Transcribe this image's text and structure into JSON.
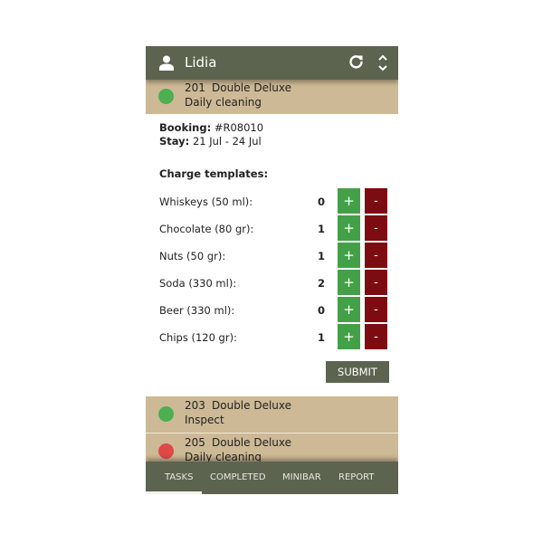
{
  "header": {
    "user_name": "Lidia",
    "icons": [
      "user-icon",
      "refresh-icon",
      "expand-collapse-icon"
    ]
  },
  "colors": {
    "header_bg": "#5c6450",
    "room_bg": "#cdb995",
    "status_green": "#4caf50",
    "status_red": "#e04848",
    "plus_bg": "#43a047",
    "minus_bg": "#7d0c12"
  },
  "rooms": [
    {
      "number": "201",
      "type": "Double Deluxe",
      "task": "Daily cleaning",
      "status": "green"
    },
    {
      "number": "203",
      "type": "Double Deluxe",
      "task": "Inspect",
      "status": "green"
    },
    {
      "number": "205",
      "type": "Double Deluxe",
      "task": "Daily cleaning",
      "status": "red"
    }
  ],
  "details": {
    "booking_label": "Booking:",
    "booking_value": "#R08010",
    "stay_label": "Stay:",
    "stay_value": "21 Jul - 24 Jul",
    "charge_templates_label": "Charge templates:",
    "charges": [
      {
        "name": "Whiskeys (50 ml):",
        "qty": "0"
      },
      {
        "name": "Chocolate (80 gr):",
        "qty": "1"
      },
      {
        "name": "Nuts (50 gr):",
        "qty": "1"
      },
      {
        "name": "Soda (330 ml):",
        "qty": "2"
      },
      {
        "name": "Beer (330 ml):",
        "qty": "0"
      },
      {
        "name": "Chips (120 gr):",
        "qty": "1"
      }
    ],
    "plus_label": "+",
    "minus_label": "-",
    "submit_label": "SUBMIT"
  },
  "tabs": [
    {
      "label": "TASKS",
      "active": true
    },
    {
      "label": "COMPLETED",
      "active": false
    },
    {
      "label": "MINIBAR",
      "active": false
    },
    {
      "label": "REPORT",
      "active": false
    }
  ]
}
